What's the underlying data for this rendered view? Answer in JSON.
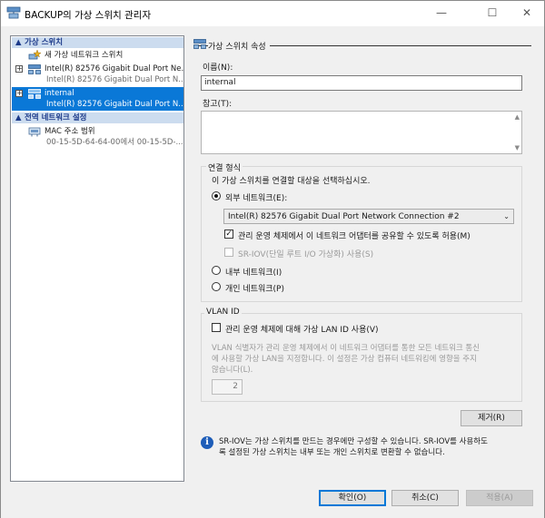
{
  "window": {
    "title": "BACKUP의 가상 스위치 관리자",
    "minimize": "—",
    "maximize": "☐",
    "close": "✕"
  },
  "sidebar": {
    "virtual_switches_header": "가상 스위치",
    "new_switch": "새 가상 네트워크 스위치",
    "switch1_name": "Intel(R) 82576 Gigabit Dual Port Ne...",
    "switch1_sub": "Intel(R) 82576 Gigabit Dual Port N...",
    "switch2_name": "internal",
    "switch2_sub": "Intel(R) 82576 Gigabit Dual Port N...",
    "global_header": "전역 네트워크 설정",
    "mac_range": "MAC 주소 범위",
    "mac_range_value": "00-15-5D-64-64-00에서 00-15-5D-..."
  },
  "properties": {
    "section_title": "가상 스위치 속성",
    "name_label": "이름(N):",
    "name_value": "internal",
    "notes_label": "참고(T):",
    "notes_value": "",
    "scroll_up": "▲",
    "scroll_down": "▼",
    "connection_type": {
      "title": "연결 형식",
      "description": "이 가상 스위치를 연결할 대상을 선택하십시오.",
      "external_label": "외부 네트워크(E):",
      "external_selected": true,
      "adapter_value": "Intel(R) 82576 Gigabit Dual Port Network Connection #2",
      "dropdown_arrow": "⌄",
      "allow_mgmt_label": "관리 운영 체제에서 이 네트워크 어댑터를 공유할 수 있도록 허용(M)",
      "allow_mgmt_checked": "✓",
      "sriov_label": "SR-IOV(단일 루트 I/O 가상화) 사용(S)",
      "internal_label": "내부 네트워크(I)",
      "private_label": "개인 네트워크(P)"
    },
    "vlan": {
      "title": "VLAN ID",
      "enable_label": "관리 운영 체제에 대해 가상 LAN ID 사용(V)",
      "desc_line1": "VLAN 식별자가 관리 운영 체제에서 이 네트워크 어댑터를 통한 모든 네트워크 통신",
      "desc_line2": "에 사용할 가상 LAN을 지정합니다. 이 설정은 가상 컴퓨터 네트워킹에 영향을 주지",
      "desc_line3": "않습니다(L).",
      "vlan_value": "2"
    },
    "remove_button": "제거(R)",
    "info_icon": "i",
    "info_line1": "SR-IOV는 가상 스위치를 만드는 경우에만 구성할 수 있습니다. SR-IOV를 사용하도",
    "info_line2": "록 설정된 가상 스위치는 내부 또는 개인 스위치로 변환할 수 없습니다."
  },
  "footer": {
    "ok": "확인(O)",
    "cancel": "취소(C)",
    "apply": "적용(A)"
  },
  "colors": {
    "selection": "#0a78d7",
    "header_bg": "#ccdcef",
    "header_text": "#1c3a8a",
    "info_blue": "#1e5db8"
  }
}
